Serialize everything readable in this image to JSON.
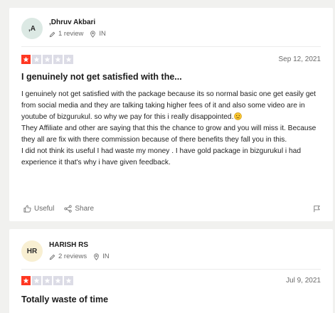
{
  "reviews": [
    {
      "avatar_initials": ",A",
      "name": ",Dhruv Akbari",
      "review_count": "1 review",
      "country": "IN",
      "rating": 1,
      "date": "Sep 12, 2021",
      "title": "I genuinely not get satisfied with the...",
      "body": [
        "I genuinely not get satisfied with the package because its so normal basic one get easily get from social media and they are talking taking higher fees of it and also some video are in youtube of bizgurukul. so why we pay for this i really disappointed.",
        "They Affiliate and other are saying that this the chance to grow and you will miss it. Because they all are fix with there commission because of there benefits they fall you in this.",
        "I did not think its useful I had waste my money . I have gold package in bizgurukul i had experience it that's why i have given feedback."
      ],
      "useful_label": "Useful",
      "share_label": "Share"
    },
    {
      "avatar_initials": "HR",
      "name": "HARISH RS",
      "review_count": "2 reviews",
      "country": "IN",
      "rating": 1,
      "date": "Jul 9, 2021",
      "title": "Totally waste of time"
    }
  ],
  "colors": {
    "star_filled": "#ff3722",
    "star_empty": "#dcdce6",
    "avatar_first": "#dce9e4",
    "avatar_second": "#f8efd2",
    "page_background": "#f1f1ef"
  },
  "icons": {
    "reviews_count": "pencil-icon",
    "location": "location-pin-icon",
    "star": "star-icon",
    "useful": "thumbs-up-icon",
    "share": "share-icon",
    "report": "flag-icon",
    "emoji": "disappointed-face-emoji"
  }
}
